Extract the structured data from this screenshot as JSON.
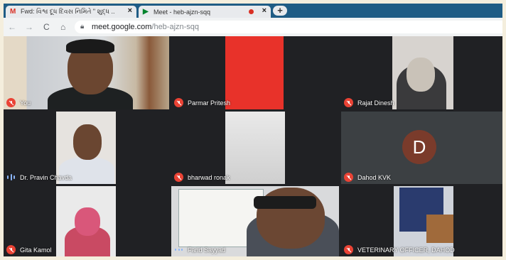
{
  "browser": {
    "tabs": [
      {
        "icon": "M",
        "title": "Fwd: વિશ્વ દૂધ દિવસ નિમિતે \" શુદ્ધ ..",
        "close": "×"
      },
      {
        "icon": "▶",
        "title": "Meet - heb-ajzn-sqq",
        "close": "×"
      }
    ],
    "new_tab": "+",
    "nav": {
      "back": "←",
      "forward": "→",
      "reload": "C",
      "home": "⌂"
    },
    "address": {
      "host": "meet.google.com",
      "path": "/heb-ajzn-sqq"
    }
  },
  "participants": [
    {
      "name": "You",
      "state": "muted"
    },
    {
      "name": "Parmar Pritesh",
      "state": "muted"
    },
    {
      "name": "Rajat Dinesh",
      "state": "muted"
    },
    {
      "name": "Dr. Pravin Chavda",
      "state": "speaking"
    },
    {
      "name": "bharwad ronak",
      "state": "muted"
    },
    {
      "name": "Dahod KVK",
      "state": "muted",
      "initial": "D"
    },
    {
      "name": "Gita Kamol",
      "state": "muted"
    },
    {
      "name": "Farid Sayyad",
      "state": "speaking"
    },
    {
      "name": "VETERINARY OFFICER, DAHOD",
      "state": "muted"
    }
  ],
  "colors": {
    "tab_strip": "#1f5c85",
    "mute_red": "#ea4335",
    "avatar_bg": "#7a3b2b",
    "grid_bg": "#202124"
  }
}
